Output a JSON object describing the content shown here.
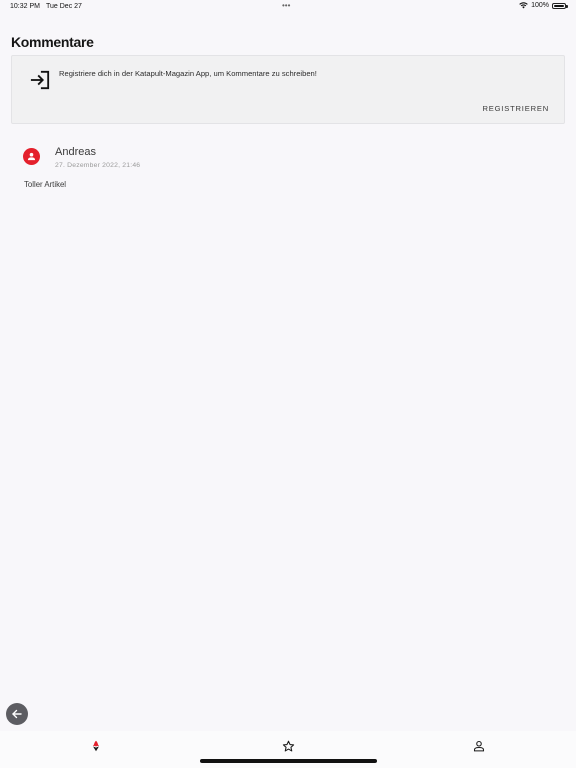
{
  "status_bar": {
    "time": "10:32 PM",
    "date": "Tue Dec 27",
    "dots": "•••",
    "battery": "100%",
    "wifi_icon": "wifi-icon",
    "battery_icon": "battery-icon"
  },
  "page": {
    "title": "Kommentare"
  },
  "register_card": {
    "icon": "login-icon",
    "message": "Registriere dich in der Katapult-Magazin App, um Kommentare zu schreiben!",
    "button_label": "REGISTRIEREN"
  },
  "comments": [
    {
      "author": "Andreas",
      "date": "27. Dezember 2022, 21:46",
      "text": "Toller Artikel",
      "avatar_icon": "user-icon",
      "avatar_color": "#e4202c"
    }
  ],
  "back_button": {
    "icon": "arrow-left-icon"
  },
  "tab_bar": {
    "tabs": [
      {
        "id": "home",
        "icon": "katapult-logo-icon",
        "active": true
      },
      {
        "id": "favorites",
        "icon": "star-icon",
        "active": false
      },
      {
        "id": "profile",
        "icon": "person-icon",
        "active": false
      }
    ]
  },
  "colors": {
    "accent": "#e4202c",
    "background": "#f8f7fa",
    "card": "#f1f1f2"
  }
}
